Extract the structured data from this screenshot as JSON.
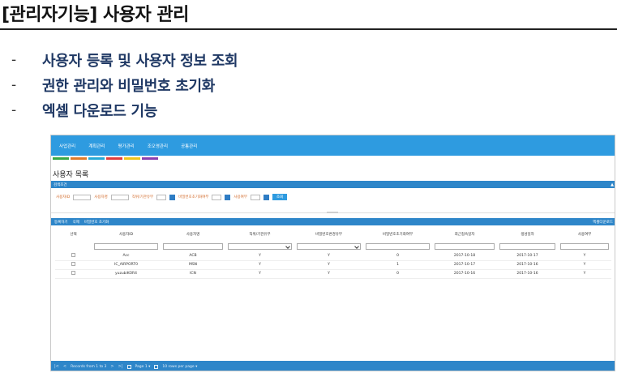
{
  "slide": {
    "title": "[관리자기능] 사용자 관리",
    "bullets": [
      {
        "dash": "-",
        "text": "사용자 등록 및 사용자 정보 조회"
      },
      {
        "dash": "-",
        "text": "권한 관리와 비밀번호 초기화"
      },
      {
        "dash": "-",
        "text": "엑셀 다운로드 기능"
      }
    ]
  },
  "app": {
    "nav": [
      "사업관리",
      "계획관리",
      "평가관리",
      "조오영관리",
      "공통관리"
    ],
    "strip_colors": [
      "#3aa845",
      "#e07b2a",
      "#25a9d6",
      "#e23c3c",
      "#f0c419",
      "#8a3fb0"
    ],
    "page_heading": "사용자 목록",
    "search_bar": {
      "title": "검색조건",
      "collapse": "▲"
    },
    "filters": {
      "label1": "사용자ID",
      "label2": "사용자명",
      "label3": "직위/기관유무",
      "label4": "비밀번호초기화여부",
      "label5": "사용여부",
      "search_button": "조회"
    },
    "grid_toolbar": {
      "left": [
        "등록하기",
        "삭제",
        "비밀번호 초기화"
      ],
      "right": "엑셀다운로드"
    },
    "columns": [
      "선택",
      "사용자ID",
      "사용자명",
      "직위/기관유무",
      "비밀번호변경유무",
      "비밀번호초기화여부",
      "최근접속일자",
      "생성일자",
      "사용여부"
    ],
    "rows": [
      [
        "",
        "Acc",
        "ACB",
        "Y",
        "Y",
        "0",
        "2017-10-18",
        "2017-10-17",
        "Y"
      ],
      [
        "",
        "IC_AIRPORT0",
        "MSN",
        "Y",
        "Y",
        "1",
        "2017-10-17",
        "2017-10-16",
        "Y"
      ],
      [
        "",
        "yuzubiKOR4",
        "ICN",
        "Y",
        "Y",
        "0",
        "2017-10-16",
        "2017-10-16",
        "Y"
      ]
    ],
    "pager": {
      "first": "|<",
      "prev": "<",
      "records": "Records from 1 to 3",
      "next": ">",
      "last": ">|",
      "page": "Page 1 ▾",
      "per_page": "10 rows per page ▾"
    }
  }
}
